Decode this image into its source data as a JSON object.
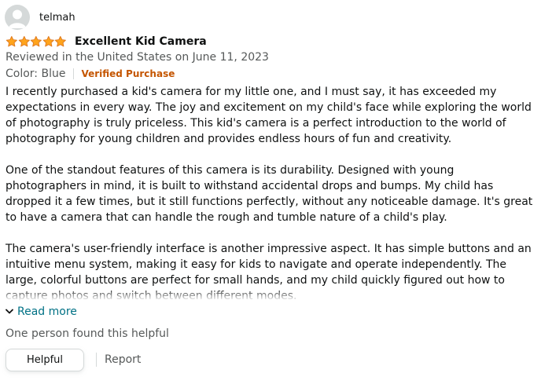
{
  "reviewer": {
    "name": "telmah",
    "avatar_icon": "default-user-avatar-icon"
  },
  "rating": {
    "stars": 5,
    "max_stars": 5,
    "star_color": "#ffa41c",
    "star_outline": "#de7921"
  },
  "review": {
    "title": "Excellent Kid Camera",
    "date_line": "Reviewed in the United States on June 11, 2023",
    "variant": "Color: Blue",
    "verified_label": "Verified Purchase",
    "paragraphs": [
      "I recently purchased a kid's camera for my little one, and I must say, it has exceeded my expectations in every way. The joy and excitement on my child's face while exploring the world of photography is truly priceless. This kid's camera is a perfect introduction to the world of photography for young children and provides endless hours of fun and creativity.",
      "One of the standout features of this camera is its durability. Designed with young photographers in mind, it is built to withstand accidental drops and bumps. My child has dropped it a few times, but it still functions perfectly, without any noticeable damage. It's great to have a camera that can handle the rough and tumble nature of a child's play.",
      "The camera's user-friendly interface is another impressive aspect. It has simple buttons and an intuitive menu system, making it easy for kids to navigate and operate independently. The large, colorful buttons are perfect for small hands, and my child quickly figured out how to capture photos and switch between different modes."
    ],
    "read_more_label": "Read more",
    "helpful_count_text": "One person found this helpful",
    "helpful_button_label": "Helpful",
    "report_label": "Report"
  },
  "colors": {
    "link": "#007185",
    "verified": "#c45500",
    "secondary_text": "#565959",
    "primary_text": "#0f1111"
  }
}
